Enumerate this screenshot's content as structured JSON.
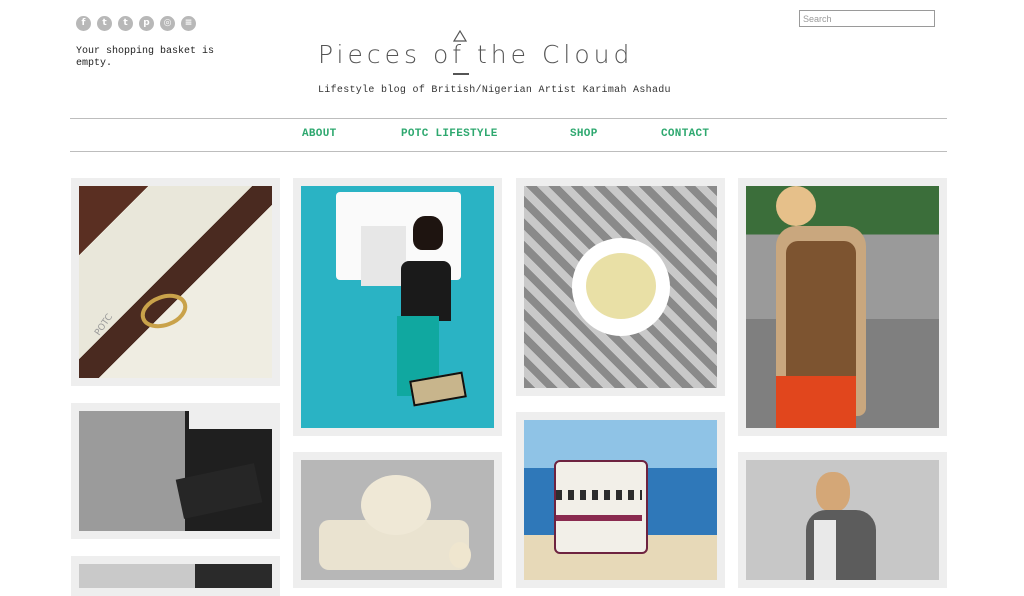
{
  "header": {
    "social": [
      {
        "icon": "facebook-icon",
        "glyph": "f"
      },
      {
        "icon": "twitter-icon",
        "glyph": "t"
      },
      {
        "icon": "tumblr-icon",
        "glyph": "t"
      },
      {
        "icon": "pinterest-icon",
        "glyph": "p"
      },
      {
        "icon": "instagram-icon",
        "glyph": "◎"
      },
      {
        "icon": "spotify-icon",
        "glyph": "≡"
      }
    ],
    "basket_text": "Your shopping basket is empty.",
    "search_placeholder": "Search",
    "logo_text": "Pieces of the Cloud",
    "tagline": "Lifestyle blog of British/Nigerian Artist Karimah Ashadu"
  },
  "nav": {
    "items": [
      "ABOUT",
      "POTC LIFESTYLE",
      "SHOP",
      "CONTACT"
    ]
  },
  "colors": {
    "accent": "#2ea86f",
    "card_bg": "#eeeeee",
    "text": "#333333"
  }
}
